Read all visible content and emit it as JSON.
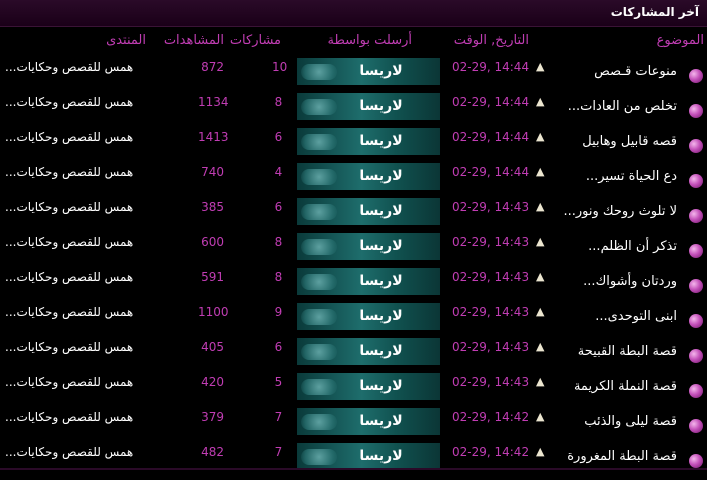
{
  "header": {
    "title": "آخر المشاركات"
  },
  "columns": {
    "topic": "الموضوع",
    "date": "التاريخ, الوقت",
    "sender": "أرسلت بواسطة",
    "replies": "مشاركات",
    "views": "المشاهدات",
    "forum": "المنتدى"
  },
  "rows": [
    {
      "title": "منوعات قـصص",
      "date": "02-29, 14:44",
      "sender": "لاريسا",
      "replies": "10",
      "views": "872",
      "forum": "همس للقصص وحكايات..."
    },
    {
      "title": "تخلص من العادات...",
      "date": "02-29, 14:44",
      "sender": "لاريسا",
      "replies": "8",
      "views": "1134",
      "forum": "همس للقصص وحكايات..."
    },
    {
      "title": "قصه قابيل وهابيل",
      "date": "02-29, 14:44",
      "sender": "لاريسا",
      "replies": "6",
      "views": "1413",
      "forum": "همس للقصص وحكايات..."
    },
    {
      "title": "دع الحياة تسير...",
      "date": "02-29, 14:44",
      "sender": "لاريسا",
      "replies": "4",
      "views": "740",
      "forum": "همس للقصص وحكايات..."
    },
    {
      "title": "لا تلوث روحك ونور...",
      "date": "02-29, 14:43",
      "sender": "لاريسا",
      "replies": "6",
      "views": "385",
      "forum": "همس للقصص وحكايات..."
    },
    {
      "title": "تذكر أن الظلم...",
      "date": "02-29, 14:43",
      "sender": "لاريسا",
      "replies": "8",
      "views": "600",
      "forum": "همس للقصص وحكايات..."
    },
    {
      "title": "وردتان وأشواك...",
      "date": "02-29, 14:43",
      "sender": "لاريسا",
      "replies": "8",
      "views": "591",
      "forum": "همس للقصص وحكايات..."
    },
    {
      "title": "ابنى التوحدى...",
      "date": "02-29, 14:43",
      "sender": "لاريسا",
      "replies": "9",
      "views": "1100",
      "forum": "همس للقصص وحكايات..."
    },
    {
      "title": "قصة البطة القبيحة",
      "date": "02-29, 14:43",
      "sender": "لاريسا",
      "replies": "6",
      "views": "405",
      "forum": "همس للقصص وحكايات..."
    },
    {
      "title": "قصة النملة الكريمة",
      "date": "02-29, 14:43",
      "sender": "لاريسا",
      "replies": "5",
      "views": "420",
      "forum": "همس للقصص وحكايات..."
    },
    {
      "title": "قصة ليلى والذئب",
      "date": "02-29, 14:42",
      "sender": "لاريسا",
      "replies": "7",
      "views": "379",
      "forum": "همس للقصص وحكايات..."
    },
    {
      "title": "قصة البطة المغرورة",
      "date": "02-29, 14:42",
      "sender": "لاريسا",
      "replies": "7",
      "views": "482",
      "forum": "همس للقصص وحكايات..."
    }
  ],
  "colors": {
    "accent": "#c03db3",
    "header_bg": "#2a0a28",
    "text": "#ffffff"
  }
}
